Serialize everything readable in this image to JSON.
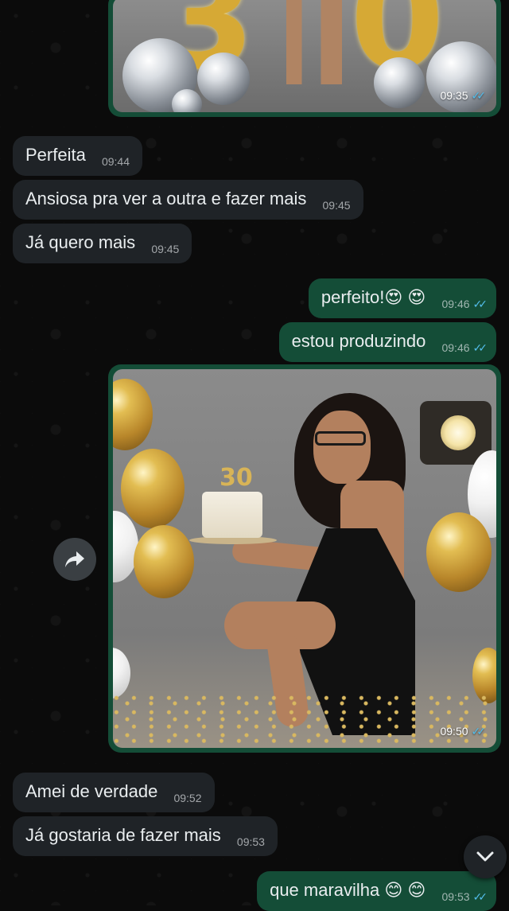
{
  "messages": {
    "img1_time": "09:35",
    "m1": {
      "text": "Perfeita",
      "time": "09:44"
    },
    "m2": {
      "text": "Ansiosa pra ver a outra e fazer mais",
      "time": "09:45"
    },
    "m3": {
      "text": "Já quero mais",
      "time": "09:45"
    },
    "m4": {
      "text": "perfeito!😍 😍",
      "time": "09:46"
    },
    "m5": {
      "text": "estou produzindo",
      "time": "09:46"
    },
    "img2_time": "09:50",
    "m6": {
      "text": "Amei de verdade",
      "time": "09:52"
    },
    "m7": {
      "text": "Já gostaria de fazer mais",
      "time": "09:53"
    },
    "m8": {
      "text": "que maravilha 😊 😊",
      "time": "09:53"
    }
  },
  "images": {
    "img1_numbers": "30",
    "cake_topper": "30"
  },
  "icons": [
    "forward-icon",
    "chevron-down-icon",
    "read-receipt-icon"
  ],
  "colors": {
    "incoming": "#1f2327",
    "outgoing": "#144d37",
    "read_ticks": "#53bdeb"
  }
}
